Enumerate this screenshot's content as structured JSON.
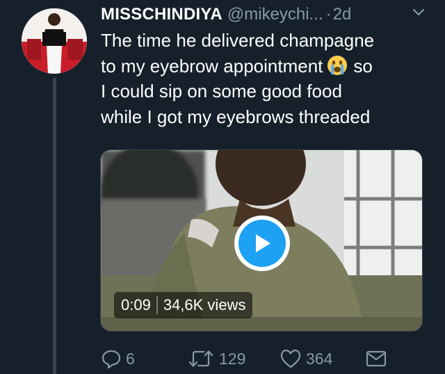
{
  "tweet": {
    "display_name": "MISSCHINDIYA",
    "handle": "@mikeychi...",
    "separator": "·",
    "time": "2d",
    "text_lines": [
      "The time he delivered champagne",
      "to my eyebrow appointment",
      "so",
      "I could sip on some good food",
      "while I got my eyebrows threaded"
    ],
    "emoji": "crying-face-emoji"
  },
  "video": {
    "duration": "0:09",
    "views": "34,6K views"
  },
  "actions": {
    "replies": "6",
    "retweets": "129",
    "likes": "364"
  },
  "colors": {
    "background": "#15202b",
    "secondary_text": "#8899a6",
    "accent_blue": "#1da1f2",
    "divider": "#38444d"
  },
  "icons": [
    "chevron-down-icon",
    "reply-icon",
    "retweet-icon",
    "like-icon",
    "message-icon",
    "play-icon"
  ]
}
